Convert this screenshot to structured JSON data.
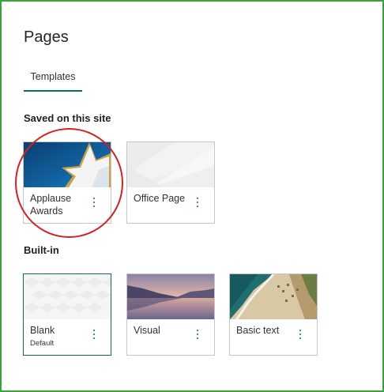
{
  "page": {
    "title": "Pages"
  },
  "tabs": [
    {
      "label": "Templates",
      "active": true
    }
  ],
  "sections": {
    "saved": {
      "heading": "Saved on this site",
      "cards": [
        {
          "name": "Applause Awards",
          "thumbnail": "star-on-blue"
        },
        {
          "name": "Office Page",
          "thumbnail": "light-grey-abstract"
        }
      ]
    },
    "builtin": {
      "heading": "Built-in",
      "cards": [
        {
          "name": "Blank",
          "subtitle": "Default",
          "thumbnail": "white-geometric",
          "selected": true
        },
        {
          "name": "Visual",
          "thumbnail": "lake-sunset"
        },
        {
          "name": "Basic text",
          "thumbnail": "aerial-beach"
        }
      ]
    }
  },
  "annotations": {
    "highlight_color": "#d62020"
  },
  "colors": {
    "accent": "#0e6a63",
    "border": "#c8c6c4",
    "frame": "#3aa33a"
  },
  "icons": {
    "card_menu": "more-vertical-icon"
  }
}
